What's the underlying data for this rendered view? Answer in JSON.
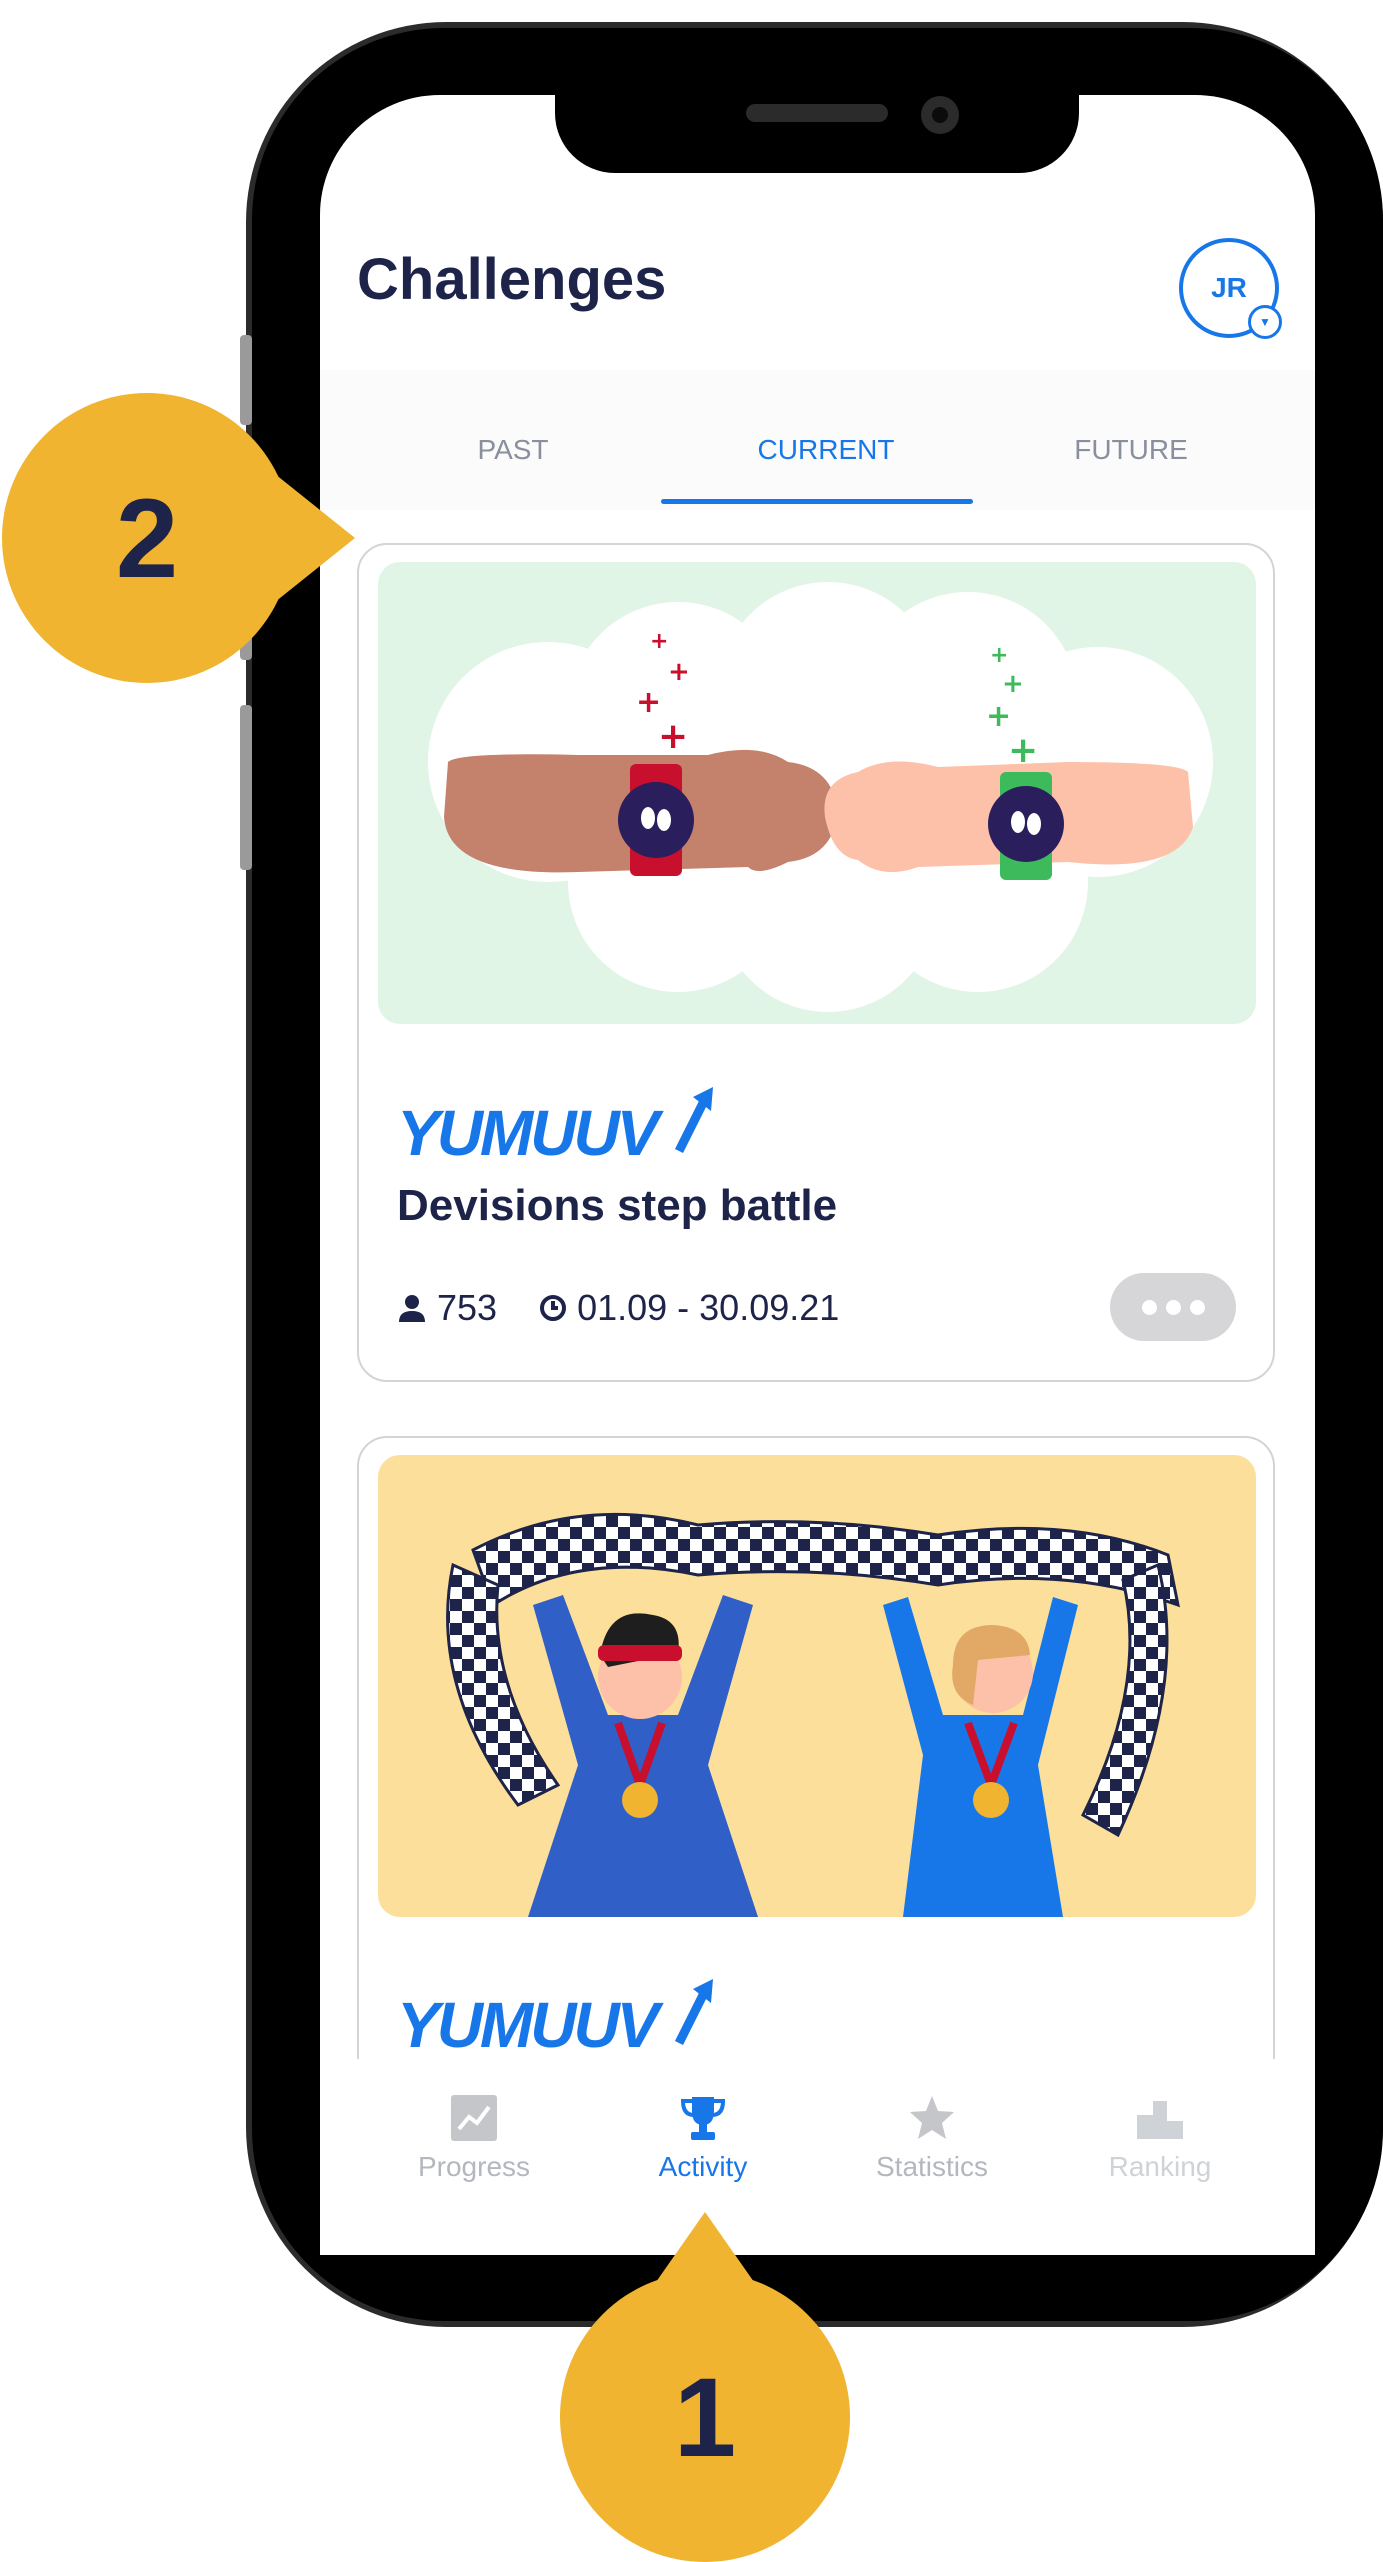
{
  "header": {
    "title": "Challenges",
    "avatar_initials": "JR"
  },
  "tabs": [
    {
      "label": "PAST",
      "active": false
    },
    {
      "label": "CURRENT",
      "active": true
    },
    {
      "label": "FUTURE",
      "active": false
    }
  ],
  "cards": [
    {
      "brand": "YUMUUV",
      "name": "Devisions step battle",
      "participants": "753",
      "dates": "01.09 - 30.09.21",
      "illustration": "fist-bump-smartwatches",
      "bg_color": "#e1f5e7"
    },
    {
      "brand": "YUMUUV",
      "illustration": "winners-with-checkered-flag",
      "bg_color": "#fddf9c"
    }
  ],
  "bottom_nav": [
    {
      "label": "Progress",
      "icon": "chart-icon",
      "active": false
    },
    {
      "label": "Activity",
      "icon": "trophy-icon",
      "active": true
    },
    {
      "label": "Statistics",
      "icon": "star-icon",
      "active": false
    },
    {
      "label": "Ranking",
      "icon": "podium-icon",
      "active": false
    }
  ],
  "callouts": [
    {
      "number": "1"
    },
    {
      "number": "2"
    }
  ],
  "colors": {
    "accent": "#1877e8",
    "navy": "#1e2449",
    "callout": "#f0b431"
  }
}
